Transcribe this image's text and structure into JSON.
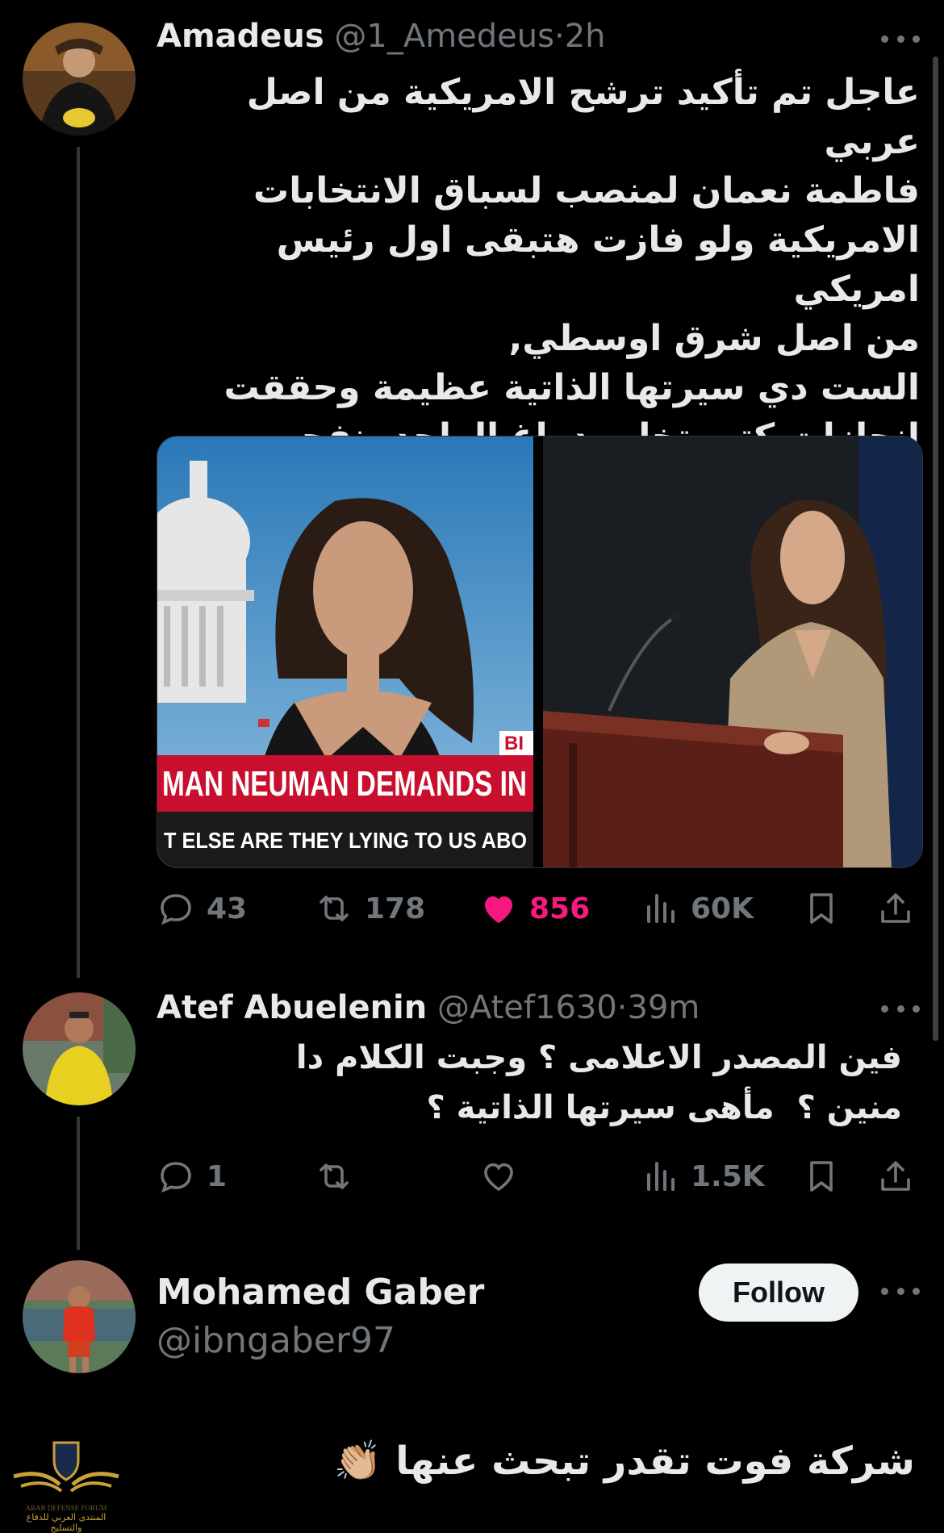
{
  "tweet": {
    "name": "Amadeus",
    "handle": "@1_Amedeus",
    "separator": "·",
    "time": "2h",
    "text": "عاجل تم تأكيد ترشح الامريكية من اصل عربي\nفاطمة نعمان لمنصب لسباق الانتخابات\nالامريكية ولو فازت هتبقى اول رئيس امريكي\nمن اصل شرق اوسطي,\nالست دي سيرتها الذاتية عظيمة وحققت\nانجازات كتير تخلي دماغ الواحد ينفجر\nادعمها ❤️",
    "media_caption_main": "MAN NEUMAN DEMANDS IN",
    "media_caption_sub": "T ELSE ARE THEY LYING TO US ABO",
    "media_badge": "BI",
    "replies": "43",
    "reposts": "178",
    "likes": "856",
    "views": "60K",
    "liked": true
  },
  "reply": {
    "name": "Atef Abuelenin",
    "handle": "@Atef1630",
    "separator": "·",
    "time": "39m",
    "text": "فين المصدر الاعلامى ؟ وجبت الكلام دا\nمنين ؟  مأهى سيرتها الذاتية ؟",
    "replies": "1",
    "reposts": "",
    "likes": "",
    "views": "1.5K"
  },
  "quote": {
    "name": "Mohamed Gaber",
    "handle": "@ibngaber97",
    "follow_label": "Follow",
    "text": "شركة فوت تقدر تبحث عنها 👏🏼"
  },
  "watermark": {
    "line1": "ARAB DEFENSE FORUM",
    "line2": "المنتدى العربي للدفاع والتسليح"
  },
  "colors": {
    "background": "#000000",
    "text": "#e7e9ea",
    "muted": "#71767b",
    "like": "#f91880",
    "follow_bg": "#eff3f4",
    "breaking_red": "#c8102e"
  },
  "icons": [
    "reply-icon",
    "repost-icon",
    "heart-icon",
    "views-icon",
    "bookmark-icon",
    "share-icon",
    "more-icon"
  ]
}
